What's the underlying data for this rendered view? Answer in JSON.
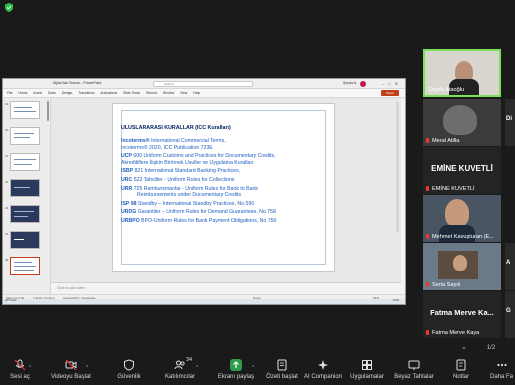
{
  "ppt": {
    "app_title": "Dijital Akıl Sunum - PowerPoint",
    "search_placeholder": "Search",
    "user": "Şeyda A.",
    "tabs": [
      "File",
      "Home",
      "Insert",
      "Draw",
      "Design",
      "Transitions",
      "Animations",
      "Slide Show",
      "Record",
      "Review",
      "View",
      "Help"
    ],
    "share_label": "Share",
    "notes_placeholder": "Click to add notes",
    "status_left": "Slide 24 of 69",
    "status_lang": "Turkish (Turkey)",
    "status_access": "Accessibility: Investigate",
    "status_notes": "Notes",
    "status_zoom": "69%",
    "weather": "20°C Açık",
    "time": "13:52"
  },
  "slide": {
    "title": "ULUSLARARASI KURALLAR (ICC Kuralları)",
    "items": [
      {
        "key": "Incoterms®",
        "text": " International Commercial Terms,",
        "line2": "Incoterms® 2020, ICC Publication 723E"
      },
      {
        "key": "UCP",
        "text": " 600 Uniform Customs and Practices for Documentary Credits,",
        "line2": "Akreditiflere İlişkin Birörnek Usuller ve Uygulama Kuralları"
      },
      {
        "key": "ISBP",
        "text": " 821 International Standard Banking Practices,",
        "line2": ""
      },
      {
        "key": "URC",
        "text": " 522 Tahsiller - Uniform Rules for Collections",
        "line2": ""
      },
      {
        "key": "URR",
        "text": " 725 Rambursmanlar - Uniform Rules for Bank to Bank",
        "line2": "Reimbursements under Documentary Credits"
      },
      {
        "key": "ISP 98",
        "text": " Standby – International Standby Practices, No.590",
        "line2": ""
      },
      {
        "key": "URDG",
        "text": " Garantiler – Uniform Rules for Demand Guarantees, No.758",
        "line2": ""
      },
      {
        "key": "URBPO",
        "text": " BPO-Uniform Rules for Bank Payment Obligations, No.750",
        "line2": ""
      }
    ]
  },
  "participants": [
    {
      "name": "Şeyda Ataoğlu"
    },
    {
      "name": "Meral Atilla"
    },
    {
      "name": "EMİNE KUVETLİ",
      "display": "EMİNE KUVETLİ"
    },
    {
      "name": "Mehmet Kavuşturan (E..."
    },
    {
      "name": "Seria Sayılı"
    },
    {
      "name": "Fatma Merve Kaya",
      "display": "Fatma  Merve  Ka..."
    }
  ],
  "edge_letters": [
    "Di",
    "A",
    "G"
  ],
  "page_indicator": "1/2",
  "toolbar": [
    {
      "label": "Sesi aç",
      "icon": "microphone-muted-icon"
    },
    {
      "label": "Videoyu Başlat",
      "icon": "video-off-icon"
    },
    {
      "label": "Güvenlik",
      "icon": "shield-icon"
    },
    {
      "label": "Katılımcılar",
      "icon": "participants-icon",
      "count": "34"
    },
    {
      "label": "Ekranı paylaş",
      "icon": "share-screen-icon"
    },
    {
      "label": "Özeti başlat",
      "icon": "summary-icon"
    },
    {
      "label": "AI Companion",
      "icon": "ai-companion-icon"
    },
    {
      "label": "Uygulamalar",
      "icon": "apps-icon"
    },
    {
      "label": "Beyaz Tahtalar",
      "icon": "whiteboard-icon"
    },
    {
      "label": "Notlar",
      "icon": "notes-icon"
    },
    {
      "label": "Daha Fa",
      "icon": "more-icon"
    }
  ],
  "colors": {
    "accent_green": "#2e9d4a",
    "slide_text": "#1f5fbf",
    "slide_title": "#002060",
    "ppt_brand": "#c43e1c"
  }
}
